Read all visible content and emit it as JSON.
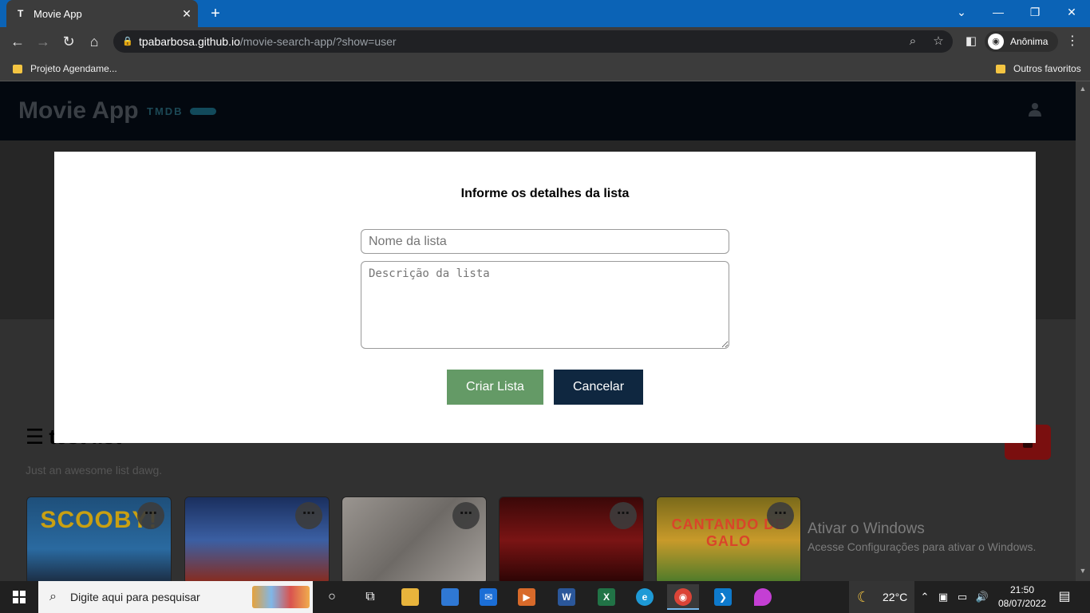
{
  "browser": {
    "tab_title": "Movie App",
    "tab_favicon": "T",
    "new_tab_label": "+",
    "url_host": "tpabarbosa.github.io",
    "url_path": "/movie-search-app/?show=user",
    "profile_label": "Anônima",
    "bookmarks": [
      "Projeto Agendame...",
      "Outros favoritos"
    ],
    "icons": [
      "back-icon",
      "forward-icon",
      "reload-icon",
      "home-icon",
      "lock-icon",
      "zoom-icon",
      "star-icon",
      "sidebar-icon",
      "incognito-icon",
      "menu-icon"
    ]
  },
  "app": {
    "logo": "Movie App",
    "tmdb": "TMDB",
    "list_title": "test list",
    "list_description": "Just an awesome list dawg.",
    "posters": [
      {
        "text": "SCOOBY!",
        "color": "#1e6aa8"
      },
      {
        "text": "",
        "color": "#224a8a"
      },
      {
        "text": "",
        "color": "#8e8a86"
      },
      {
        "text": "",
        "color": "#7a1414"
      },
      {
        "text": "CANTANDO DE GALO",
        "color": "#c89a2a"
      }
    ],
    "poster_menu": "⋯"
  },
  "modal": {
    "title": "Informe os detalhes da lista",
    "name_placeholder": "Nome da lista",
    "desc_placeholder": "Descrição da lista",
    "create_label": "Criar Lista",
    "cancel_label": "Cancelar",
    "colors": {
      "create": "#649a66",
      "cancel": "#0f2740"
    }
  },
  "watermark": {
    "line1": "Ativar o Windows",
    "line2": "Acesse Configurações para ativar o Windows."
  },
  "taskbar": {
    "search_placeholder": "Digite aqui para pesquisar",
    "temperature": "22°C",
    "time": "21:50",
    "date": "08/07/2022"
  }
}
